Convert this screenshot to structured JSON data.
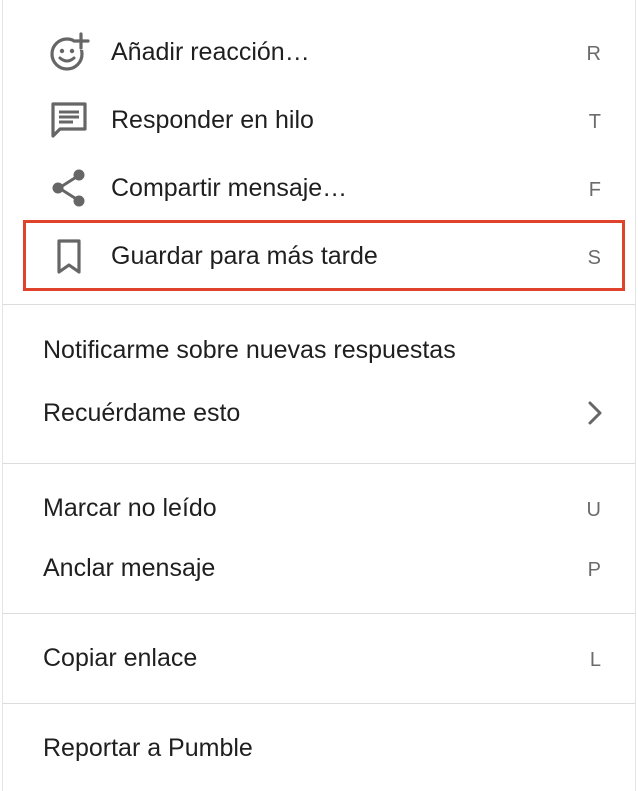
{
  "menu": {
    "items": [
      {
        "label": "Añadir reacción…",
        "shortcut": "R",
        "icon": "add-reaction-icon"
      },
      {
        "label": "Responder en hilo",
        "shortcut": "T",
        "icon": "thread-comment-icon"
      },
      {
        "label": "Compartir mensaje…",
        "shortcut": "F",
        "icon": "share-icon"
      },
      {
        "label": "Guardar para más tarde",
        "shortcut": "S",
        "icon": "bookmark-icon"
      },
      {
        "label": "Notificarme sobre nuevas respuestas"
      },
      {
        "label": "Recuérdame esto",
        "icon": "chevron-right-icon"
      },
      {
        "label": "Marcar no leído",
        "shortcut": "U"
      },
      {
        "label": "Anclar mensaje",
        "shortcut": "P"
      },
      {
        "label": "Copiar enlace",
        "shortcut": "L"
      },
      {
        "label": "Reportar a Pumble"
      }
    ]
  },
  "colors": {
    "text": "#1f1f1f",
    "shortcut": "#6b6b6b",
    "icon": "#666666",
    "highlight": "#e0432c",
    "divider": "#dcdcdc"
  }
}
